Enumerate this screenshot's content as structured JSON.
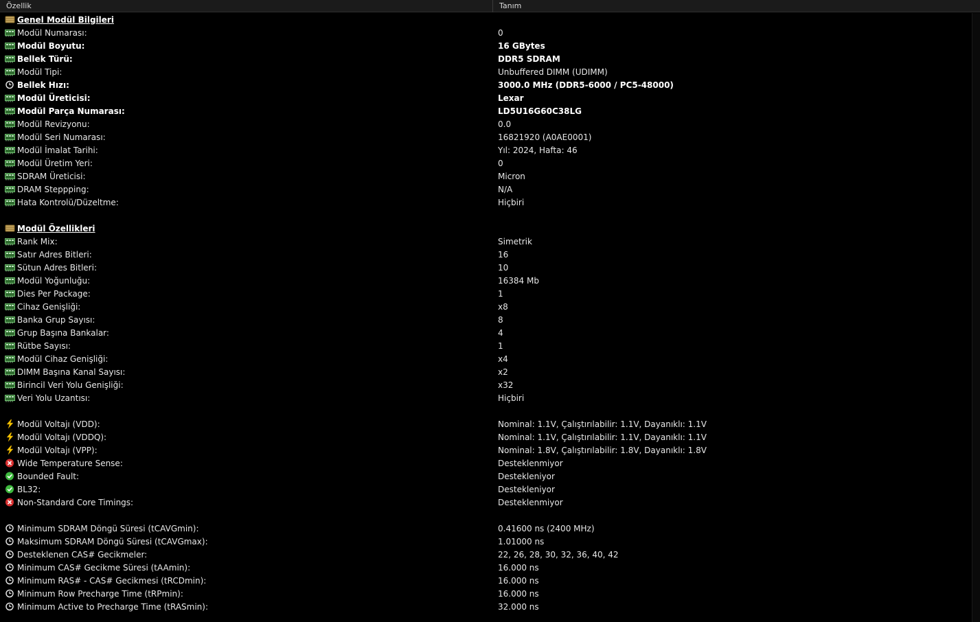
{
  "header": {
    "col1": "Özellik",
    "col2": "Tanım"
  },
  "rows": [
    {
      "type": "section",
      "icon": "memory-module-icon",
      "label": "Genel Modül Bilgileri",
      "value": ""
    },
    {
      "icon": "chip-icon",
      "label": "Modül Numarası:",
      "value": "0"
    },
    {
      "icon": "chip-icon",
      "label": "Modül Boyutu:",
      "value": "16 GBytes",
      "bold": true
    },
    {
      "icon": "chip-icon",
      "label": "Bellek Türü:",
      "value": "DDR5 SDRAM",
      "bold": true
    },
    {
      "icon": "chip-icon",
      "label": "Modül Tipi:",
      "value": "Unbuffered DIMM (UDIMM)"
    },
    {
      "icon": "clock-icon",
      "label": "Bellek Hızı:",
      "value": "3000.0 MHz (DDR5-6000 / PC5-48000)",
      "bold": true
    },
    {
      "icon": "chip-icon",
      "label": "Modül Üreticisi:",
      "value": "Lexar",
      "bold": true
    },
    {
      "icon": "chip-icon",
      "label": "Modül Parça Numarası:",
      "value": "LD5U16G60C38LG",
      "bold": true
    },
    {
      "icon": "chip-icon",
      "label": "Modül Revizyonu:",
      "value": "0.0"
    },
    {
      "icon": "chip-icon",
      "label": "Modül Seri Numarası:",
      "value": "16821920 (A0AE0001)"
    },
    {
      "icon": "chip-icon",
      "label": "Modül İmalat Tarihi:",
      "value": "Yıl: 2024, Hafta: 46"
    },
    {
      "icon": "chip-icon",
      "label": "Modül Üretim Yeri:",
      "value": "0"
    },
    {
      "icon": "chip-icon",
      "label": "SDRAM Üreticisi:",
      "value": "Micron"
    },
    {
      "icon": "chip-icon",
      "label": "DRAM Steppping:",
      "value": "N/A"
    },
    {
      "icon": "chip-icon",
      "label": "Hata Kontrolü/Düzeltme:",
      "value": "Hiçbiri"
    },
    {
      "type": "blank"
    },
    {
      "type": "section",
      "icon": "memory-module-icon",
      "label": "Modül Özellikleri",
      "value": ""
    },
    {
      "icon": "chip-icon",
      "label": "Rank Mix:",
      "value": "Simetrik"
    },
    {
      "icon": "chip-icon",
      "label": "Satır Adres Bitleri:",
      "value": "16"
    },
    {
      "icon": "chip-icon",
      "label": "Sütun Adres Bitleri:",
      "value": "10"
    },
    {
      "icon": "chip-icon",
      "label": "Modül Yoğunluğu:",
      "value": "16384 Mb"
    },
    {
      "icon": "chip-icon",
      "label": "Dies Per Package:",
      "value": "1"
    },
    {
      "icon": "chip-icon",
      "label": "Cihaz Genişliği:",
      "value": "x8"
    },
    {
      "icon": "chip-icon",
      "label": "Banka Grup Sayısı:",
      "value": "8"
    },
    {
      "icon": "chip-icon",
      "label": "Grup Başına Bankalar:",
      "value": "4"
    },
    {
      "icon": "chip-icon",
      "label": "Rütbe Sayısı:",
      "value": "1"
    },
    {
      "icon": "chip-icon",
      "label": "Modül Cihaz Genişliği:",
      "value": "x4"
    },
    {
      "icon": "chip-icon",
      "label": "DIMM Başına Kanal Sayısı:",
      "value": "x2"
    },
    {
      "icon": "chip-icon",
      "label": "Birincil Veri Yolu Genişliği:",
      "value": "x32"
    },
    {
      "icon": "chip-icon",
      "label": "Veri Yolu Uzantısı:",
      "value": "Hiçbiri"
    },
    {
      "type": "blank"
    },
    {
      "icon": "lightning-icon",
      "label": "Modül Voltajı (VDD):",
      "value": "Nominal: 1.1V, Çalıştırılabilir: 1.1V, Dayanıklı: 1.1V"
    },
    {
      "icon": "lightning-icon",
      "label": "Modül Voltajı (VDDQ):",
      "value": "Nominal: 1.1V, Çalıştırılabilir: 1.1V, Dayanıklı: 1.1V"
    },
    {
      "icon": "lightning-icon",
      "label": "Modül Voltajı (VPP):",
      "value": "Nominal: 1.8V, Çalıştırılabilir: 1.8V, Dayanıklı: 1.8V"
    },
    {
      "icon": "x-circle-icon",
      "label": "Wide Temperature Sense:",
      "value": "Desteklenmiyor"
    },
    {
      "icon": "check-circle-icon",
      "label": "Bounded Fault:",
      "value": "Destekleniyor"
    },
    {
      "icon": "check-circle-icon",
      "label": "BL32:",
      "value": "Destekleniyor"
    },
    {
      "icon": "x-circle-icon",
      "label": "Non-Standard Core Timings:",
      "value": "Desteklenmiyor"
    },
    {
      "type": "blank"
    },
    {
      "icon": "clock-icon",
      "label": "Minimum SDRAM Döngü Süresi (tCAVGmin):",
      "value": "0.41600 ns (2400 MHz)"
    },
    {
      "icon": "clock-icon",
      "label": "Maksimum SDRAM Döngü Süresi (tCAVGmax):",
      "value": "1.01000 ns"
    },
    {
      "icon": "clock-icon",
      "label": "Desteklenen CAS# Gecikmeler:",
      "value": "22, 26, 28, 30, 32, 36, 40, 42"
    },
    {
      "icon": "clock-icon",
      "label": "Minimum CAS# Gecikme Süresi (tAAmin):",
      "value": "16.000 ns"
    },
    {
      "icon": "clock-icon",
      "label": "Minimum RAS# - CAS# Gecikmesi (tRCDmin):",
      "value": "16.000 ns"
    },
    {
      "icon": "clock-icon",
      "label": "Minimum Row Precharge Time (tRPmin):",
      "value": "16.000 ns"
    },
    {
      "icon": "clock-icon",
      "label": "Minimum Active to Precharge Time (tRASmin):",
      "value": "32.000 ns"
    }
  ]
}
